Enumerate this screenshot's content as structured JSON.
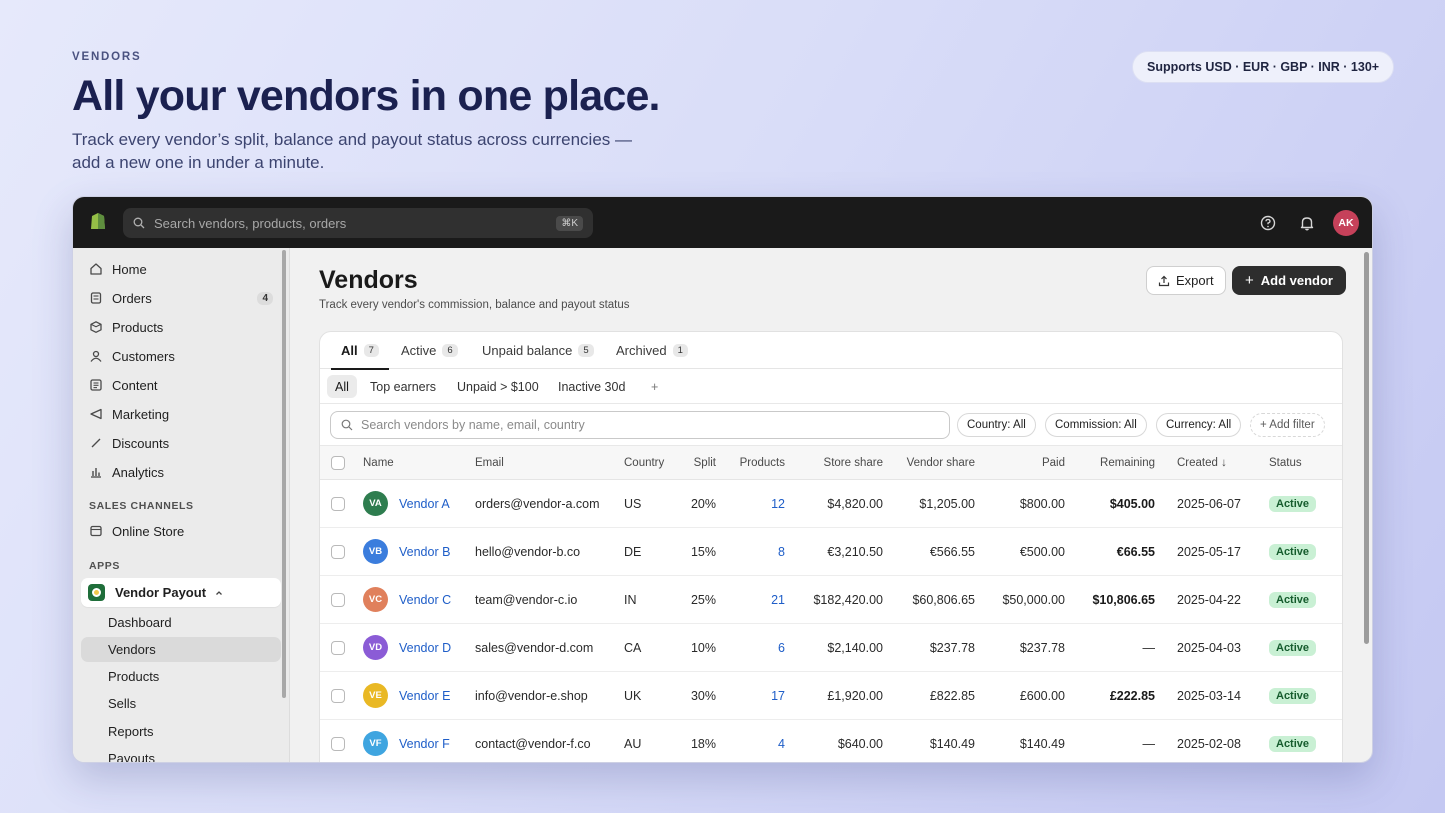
{
  "hero": {
    "eyebrow": "VENDORS",
    "title": "All your vendors in one place.",
    "subtitle": "Track every vendor’s split, balance and payout status across currencies — add a new one in under a minute.",
    "currency_pill": "Supports USD · EUR · GBP · INR · 130+"
  },
  "topbar": {
    "search_placeholder": "Search vendors, products, orders",
    "shortcut": "⌘K",
    "avatar_initials": "AK",
    "avatar_color": "#c6415a"
  },
  "sidebar": {
    "items": [
      {
        "label": "Home",
        "icon": "home-icon"
      },
      {
        "label": "Orders",
        "icon": "orders-icon",
        "badge": "4"
      },
      {
        "label": "Products",
        "icon": "products-icon"
      },
      {
        "label": "Customers",
        "icon": "customers-icon"
      },
      {
        "label": "Content",
        "icon": "content-icon"
      },
      {
        "label": "Marketing",
        "icon": "marketing-icon"
      },
      {
        "label": "Discounts",
        "icon": "discounts-icon"
      },
      {
        "label": "Analytics",
        "icon": "analytics-icon"
      }
    ],
    "sales_channels_title": "SALES CHANNELS",
    "online_store": "Online Store",
    "apps_title": "APPS",
    "app_name": "Vendor Payout",
    "sub_items": [
      "Dashboard",
      "Vendors",
      "Products",
      "Sells",
      "Reports",
      "Payouts"
    ]
  },
  "main": {
    "title": "Vendors",
    "subtitle": "Track every vendor's commission, balance and payout status",
    "export_label": "Export",
    "add_label": "Add vendor",
    "tabs": [
      {
        "label": "All",
        "count": "7"
      },
      {
        "label": "Active",
        "count": "6"
      },
      {
        "label": "Unpaid balance",
        "count": "5"
      },
      {
        "label": "Archived",
        "count": "1"
      }
    ],
    "views": [
      "All",
      "Top earners",
      "Unpaid > $100",
      "Inactive 30d",
      "+"
    ],
    "table_search_placeholder": "Search vendors by name, email, country",
    "filters": [
      "Country: All",
      "Commission: All",
      "Currency: All",
      "+ Add filter"
    ],
    "columns": {
      "name": "Name",
      "email": "Email",
      "country": "Country",
      "split": "Split",
      "products": "Products",
      "store_share": "Store share",
      "vendor_share": "Vendor share",
      "paid": "Paid",
      "remaining": "Remaining",
      "created": "Created ↓",
      "status": "Status"
    },
    "rows": [
      {
        "initials": "VA",
        "color": "#2e7d4f",
        "name": "Vendor A",
        "email": "orders@vendor-a.com",
        "country": "US",
        "split": "20%",
        "products": "12",
        "store_share": "$4,820.00",
        "vendor_share": "$1,205.00",
        "paid": "$800.00",
        "remaining": "$405.00",
        "created": "2025-06-07",
        "status": "Active"
      },
      {
        "initials": "VB",
        "color": "#3b7ddd",
        "name": "Vendor B",
        "email": "hello@vendor-b.co",
        "country": "DE",
        "split": "15%",
        "products": "8",
        "store_share": "€3,210.50",
        "vendor_share": "€566.55",
        "paid": "€500.00",
        "remaining": "€66.55",
        "created": "2025-05-17",
        "status": "Active"
      },
      {
        "initials": "VC",
        "color": "#e0805c",
        "name": "Vendor C",
        "email": "team@vendor-c.io",
        "country": "IN",
        "split": "25%",
        "products": "21",
        "store_share": "$182,420.00",
        "vendor_share": "$60,806.65",
        "paid": "$50,000.00",
        "remaining": "$10,806.65",
        "created": "2025-04-22",
        "status": "Active"
      },
      {
        "initials": "VD",
        "color": "#8b5cd6",
        "name": "Vendor D",
        "email": "sales@vendor-d.com",
        "country": "CA",
        "split": "10%",
        "products": "6",
        "store_share": "$2,140.00",
        "vendor_share": "$237.78",
        "paid": "$237.78",
        "remaining": "—",
        "created": "2025-04-03",
        "status": "Active"
      },
      {
        "initials": "VE",
        "color": "#e9b824",
        "name": "Vendor E",
        "email": "info@vendor-e.shop",
        "country": "UK",
        "split": "30%",
        "products": "17",
        "store_share": "£1,920.00",
        "vendor_share": "£822.85",
        "paid": "£600.00",
        "remaining": "£222.85",
        "created": "2025-03-14",
        "status": "Active"
      },
      {
        "initials": "VF",
        "color": "#3fa5e0",
        "name": "Vendor F",
        "email": "contact@vendor-f.co",
        "country": "AU",
        "split": "18%",
        "products": "4",
        "store_share": "$640.00",
        "vendor_share": "$140.49",
        "paid": "$140.49",
        "remaining": "—",
        "created": "2025-02-08",
        "status": "Active"
      }
    ]
  }
}
